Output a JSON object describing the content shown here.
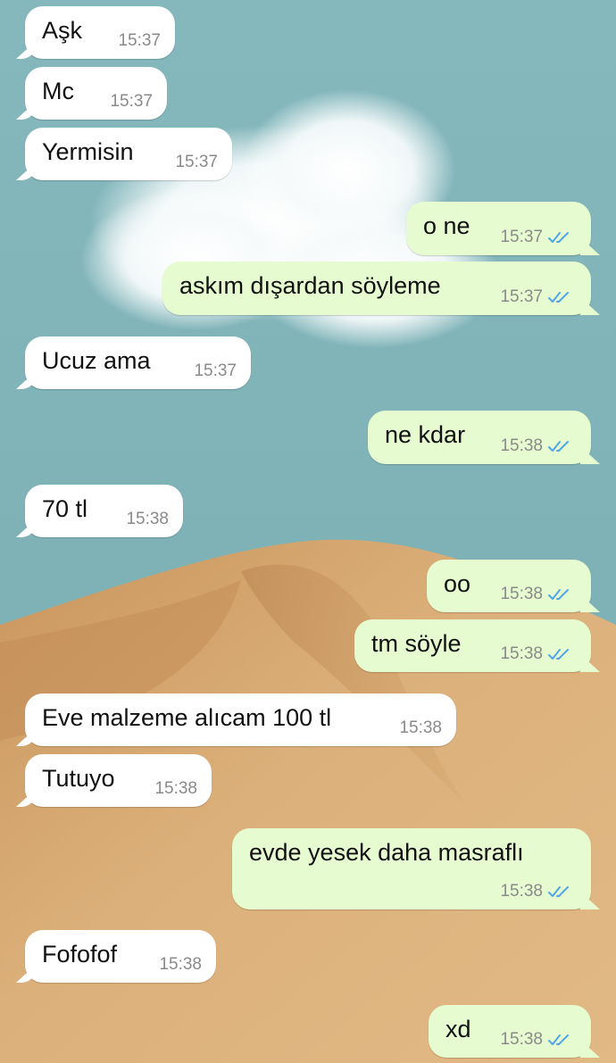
{
  "colors": {
    "sky": "#7fb2b7",
    "sand": "#d6a970",
    "incoming_bubble": "#ffffff",
    "outgoing_bubble": "#e6fbd0",
    "read_ticks": "#4fa6e8"
  },
  "messages": [
    {
      "dir": "in",
      "text": "Aşk",
      "time": "15:37"
    },
    {
      "dir": "in",
      "text": "Mc",
      "time": "15:37"
    },
    {
      "dir": "in",
      "text": "Yermisin",
      "time": "15:37"
    },
    {
      "dir": "out",
      "text": "o ne",
      "time": "15:37",
      "status_icon": "double-check-icon"
    },
    {
      "dir": "out",
      "text": "askım dışardan söyleme",
      "time": "15:37",
      "status_icon": "double-check-icon"
    },
    {
      "dir": "in",
      "text": "Ucuz ama",
      "time": "15:37"
    },
    {
      "dir": "out",
      "text": "ne kdar",
      "time": "15:38",
      "status_icon": "double-check-icon"
    },
    {
      "dir": "in",
      "text": "70 tl",
      "time": "15:38"
    },
    {
      "dir": "out",
      "text": "oo",
      "time": "15:38",
      "status_icon": "double-check-icon"
    },
    {
      "dir": "out",
      "text": "tm söyle",
      "time": "15:38",
      "status_icon": "double-check-icon"
    },
    {
      "dir": "in",
      "text": "Eve malzeme alıcam 100 tl",
      "time": "15:38"
    },
    {
      "dir": "in",
      "text": "Tutuyo",
      "time": "15:38"
    },
    {
      "dir": "out",
      "text": "evde yesek daha masraflı",
      "time": "15:38",
      "status_icon": "double-check-icon"
    },
    {
      "dir": "in",
      "text": "Fofofof",
      "time": "15:38"
    },
    {
      "dir": "out",
      "text": "xd",
      "time": "15:38",
      "status_icon": "double-check-icon"
    }
  ]
}
